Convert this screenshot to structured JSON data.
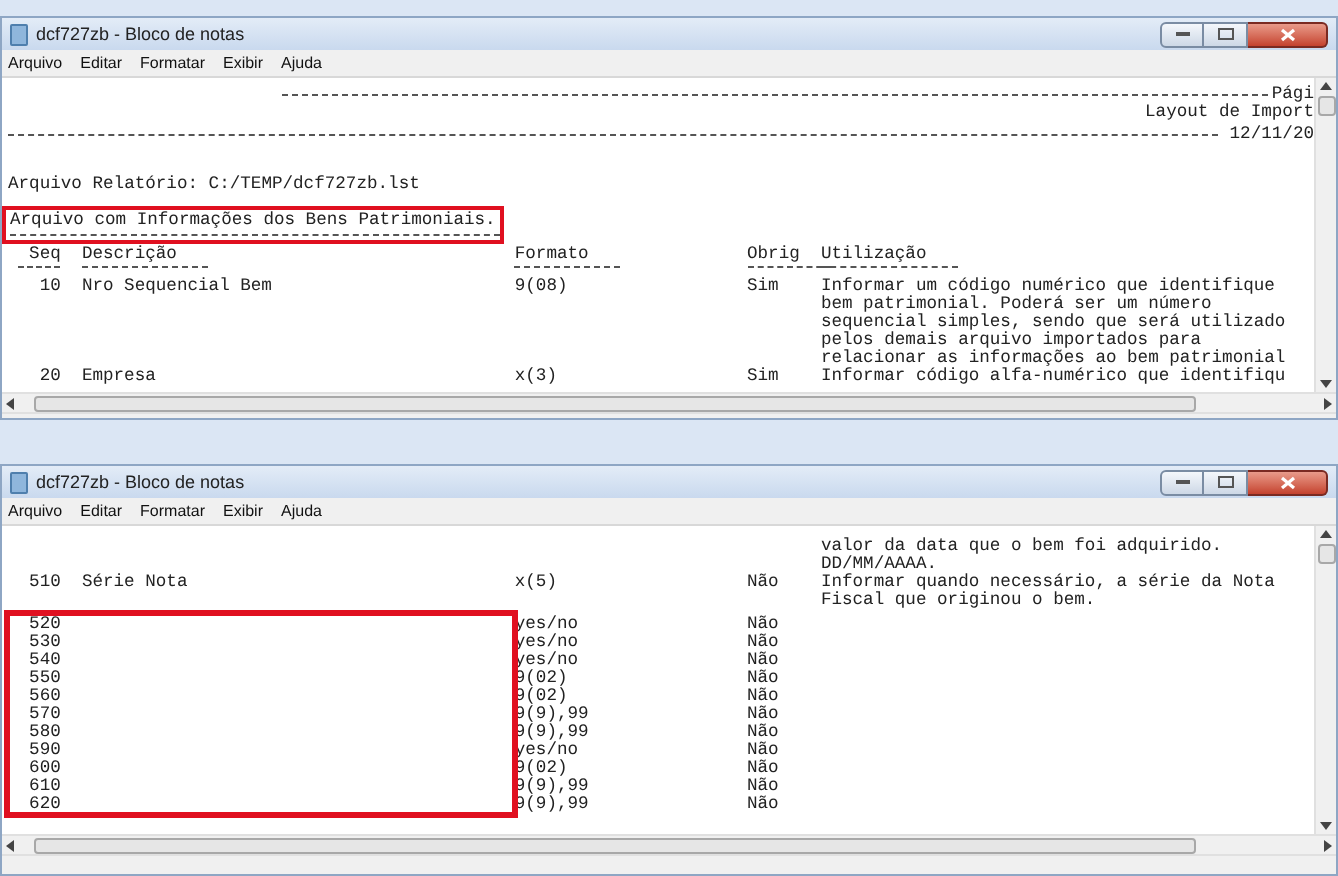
{
  "windows": [
    {
      "title": "dcf727zb - Bloco de notas",
      "menu": [
        "Arquivo",
        "Editar",
        "Formatar",
        "Exibir",
        "Ajuda"
      ],
      "header": {
        "page": "Pági",
        "layout": "Layout de Import",
        "date": "12/11/20"
      },
      "report_file": "Arquivo Relatório: C:/TEMP/dcf727zb.lst",
      "boxed_note": "Arquivo com Informações dos Bens Patrimoniais.",
      "columns": [
        "Seq",
        "Descrição",
        "Formato",
        "Obrig",
        "Utilização"
      ],
      "rows": [
        {
          "seq": "10",
          "description": "Nro Sequencial Bem",
          "format": "9(08)",
          "required": "Sim",
          "usage": [
            "Informar um código numérico que identifique",
            "bem patrimonial. Poderá ser um número",
            "sequencial simples, sendo que será utilizado",
            "pelos demais arquivo importados para",
            "relacionar as informações ao bem patrimonial"
          ]
        },
        {
          "seq": "20",
          "description": "Empresa",
          "format": "x(3)",
          "required": "Sim",
          "usage": [
            "Informar código alfa-numérico que identifiqu"
          ]
        }
      ]
    },
    {
      "title": "dcf727zb - Bloco de notas",
      "menu": [
        "Arquivo",
        "Editar",
        "Formatar",
        "Exibir",
        "Ajuda"
      ],
      "rows": [
        {
          "usage": [
            "valor da data que o bem foi adquirido.",
            "DD/MM/AAAA."
          ]
        },
        {
          "seq": "510",
          "description": "Série Nota",
          "format": "x(5)",
          "required": "Não",
          "usage": [
            "Informar quando necessário, a série da Nota",
            "Fiscal que originou o bem."
          ]
        }
      ],
      "boxed_rows": [
        {
          "seq": "520",
          "format": "yes/no",
          "required": "Não"
        },
        {
          "seq": "530",
          "format": "yes/no",
          "required": "Não"
        },
        {
          "seq": "540",
          "format": "yes/no",
          "required": "Não"
        },
        {
          "seq": "550",
          "format": "9(02)",
          "required": "Não"
        },
        {
          "seq": "560",
          "format": "9(02)",
          "required": "Não"
        },
        {
          "seq": "570",
          "format": "9(9),99",
          "required": "Não"
        },
        {
          "seq": "580",
          "format": "9(9),99",
          "required": "Não"
        },
        {
          "seq": "590",
          "format": "yes/no",
          "required": "Não"
        },
        {
          "seq": "600",
          "format": "9(02)",
          "required": "Não"
        },
        {
          "seq": "610",
          "format": "9(9),99",
          "required": "Não"
        },
        {
          "seq": "620",
          "format": "9(9),99",
          "required": "Não"
        }
      ]
    }
  ]
}
